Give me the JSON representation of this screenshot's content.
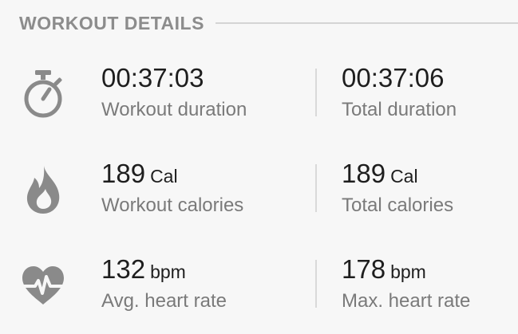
{
  "section": {
    "title": "WORKOUT DETAILS"
  },
  "colors": {
    "background": "#f7f7f7",
    "icon": "#8a8a8a",
    "value_text": "#1e1e1e",
    "label_text": "#7a7a7a",
    "header_text": "#8c8c8c"
  },
  "rows": [
    {
      "icon": "stopwatch-icon",
      "left": {
        "value": "00:37:03",
        "unit": "",
        "label": "Workout duration"
      },
      "right": {
        "value": "00:37:06",
        "unit": "",
        "label": "Total duration"
      }
    },
    {
      "icon": "flame-icon",
      "left": {
        "value": "189",
        "unit": "Cal",
        "label": "Workout calories"
      },
      "right": {
        "value": "189",
        "unit": "Cal",
        "label": "Total calories"
      }
    },
    {
      "icon": "heart-rate-icon",
      "left": {
        "value": "132",
        "unit": "bpm",
        "label": "Avg. heart rate"
      },
      "right": {
        "value": "178",
        "unit": "bpm",
        "label": "Max. heart rate"
      }
    }
  ]
}
